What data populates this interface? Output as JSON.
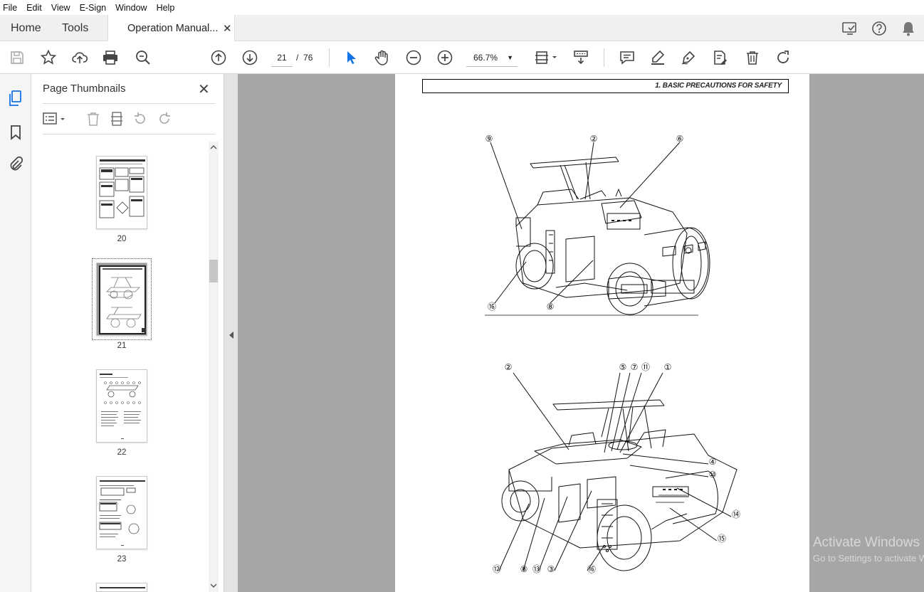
{
  "menu": [
    "File",
    "Edit",
    "View",
    "E-Sign",
    "Window",
    "Help"
  ],
  "tabs": {
    "home": "Home",
    "tools": "Tools",
    "document": "Operation Manual...",
    "close": "✕"
  },
  "toolbar": {
    "page_current": "21",
    "page_separator": "/",
    "page_total": "76",
    "zoom": "66.7%"
  },
  "panel": {
    "title": "Page Thumbnails",
    "close": "✕",
    "thumbnails": [
      {
        "label": "20"
      },
      {
        "label": "21",
        "selected": true
      },
      {
        "label": "22"
      },
      {
        "label": "23"
      }
    ]
  },
  "document": {
    "header": "1. BASIC PRECAUTIONS FOR SAFETY",
    "callouts_top": [
      "⑨",
      "②",
      "⑥",
      "⑯",
      "⑧"
    ],
    "callouts_bottom": [
      "②",
      "⑤",
      "⑦",
      "⑪",
      "①",
      "④",
      "⑩",
      "⑭",
      "⑮",
      "⑫",
      "⑧",
      "⑬",
      "③",
      "⑯"
    ]
  },
  "watermark": {
    "line1": "Activate Windows",
    "line2": "Go to Settings to activate Windows."
  },
  "colors": {
    "accent": "#1473e6",
    "doc_bg": "#a6a6a6",
    "toolbar_icon": "#444444"
  }
}
